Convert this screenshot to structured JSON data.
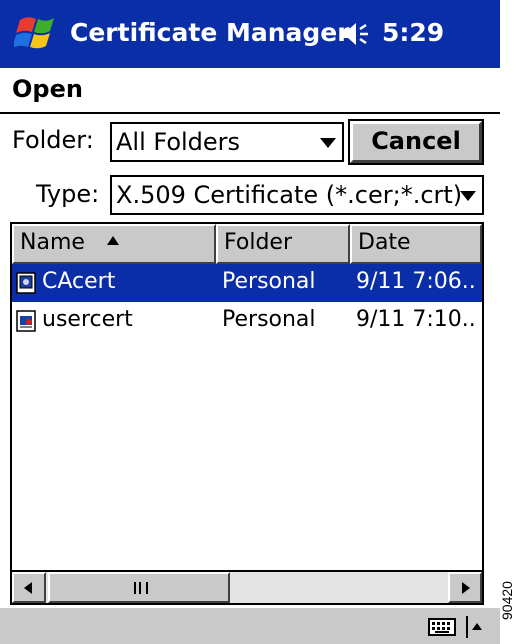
{
  "titlebar": {
    "title": "Certificate Manager",
    "time": "5:29",
    "icons": [
      "windows-flag-icon",
      "speaker-icon"
    ],
    "background": "#0a2ea8"
  },
  "dialog": {
    "title": "Open",
    "folder_label": "Folder:",
    "folder_value": "All Folders",
    "type_label": "Type:",
    "type_value": "X.509 Certificate (*.cer;*.crt)",
    "cancel_label": "Cancel"
  },
  "list": {
    "columns": [
      "Name",
      "Folder",
      "Date"
    ],
    "sort_column": "Name",
    "sort_direction": "ascending",
    "rows": [
      {
        "name": "CAcert",
        "folder": "Personal",
        "date": "9/11 7:06..",
        "icon": "certificate-icon",
        "selected": true
      },
      {
        "name": "usercert",
        "folder": "Personal",
        "date": "9/11 7:10..",
        "icon": "certificate-file-icon",
        "selected": false
      }
    ],
    "selection_color": "#0a2ea8"
  },
  "menubar": {
    "icons": [
      "keyboard-icon",
      "input-panel-arrow-icon"
    ]
  },
  "figure_code": "90420"
}
